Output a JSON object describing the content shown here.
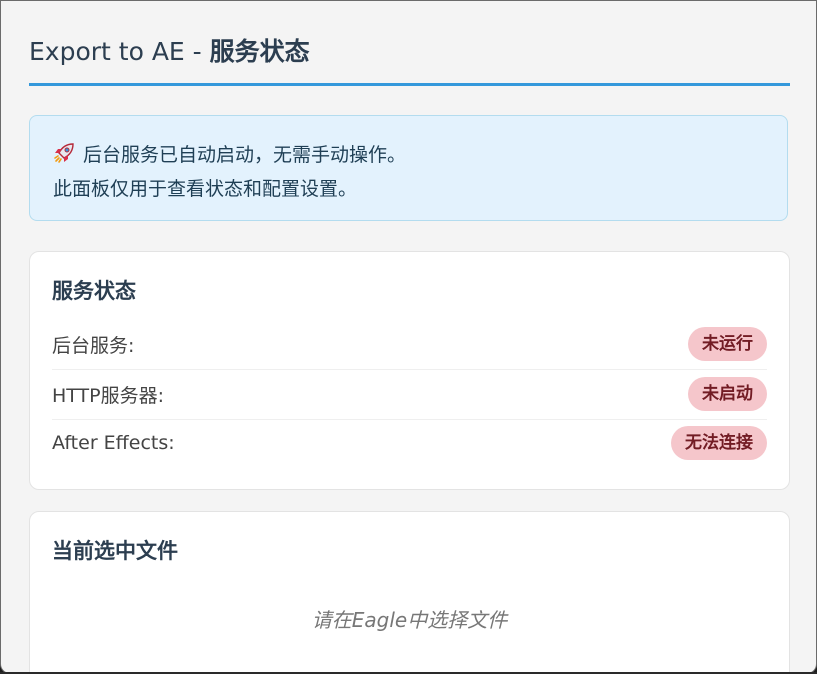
{
  "header": {
    "title_prefix": "Export to AE - ",
    "title_main": "服务状态"
  },
  "notice": {
    "line1": "后台服务已自动启动，无需手动操作。",
    "line2": "此面板仅用于查看状态和配置设置。",
    "icon": "rocket-icon"
  },
  "service_status": {
    "title": "服务状态",
    "rows": [
      {
        "label": "后台服务:",
        "status": "未运行"
      },
      {
        "label": "HTTP服务器:",
        "status": "未启动"
      },
      {
        "label": "After Effects:",
        "status": "无法连接"
      }
    ]
  },
  "current_file": {
    "title": "当前选中文件",
    "empty_hint": "请在Eagle中选择文件"
  },
  "colors": {
    "accent": "#3498db",
    "error_badge_bg": "#f5c6cb",
    "error_badge_text": "#721c24",
    "notice_bg": "#e3f2fd"
  }
}
